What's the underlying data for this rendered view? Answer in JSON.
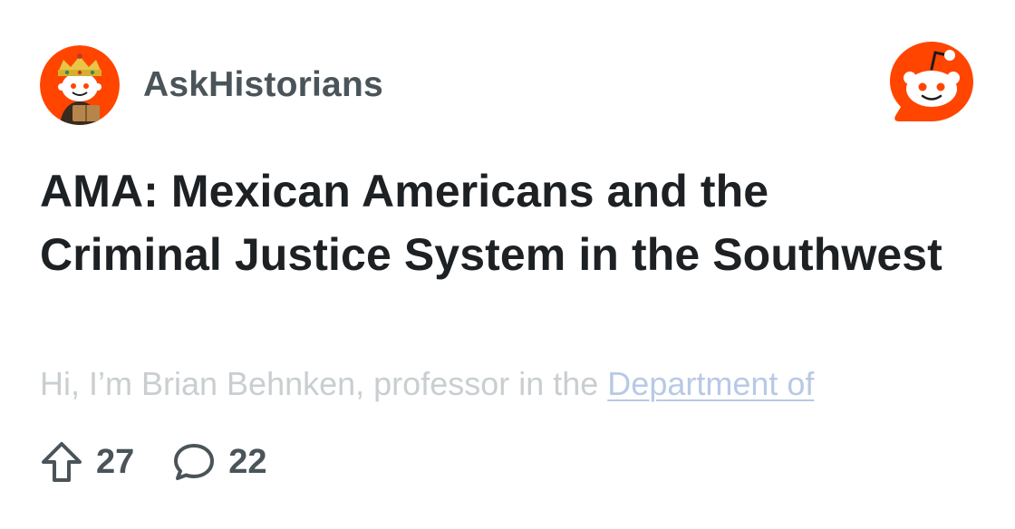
{
  "subreddit": {
    "name": "AskHistorians",
    "avatar_icon": "subreddit-avatar-snoo-crown-icon"
  },
  "brand": {
    "logo_icon": "reddit-logo-icon",
    "color": "#ff4500"
  },
  "post": {
    "title": "AMA: Mexican Americans and the Criminal Justice System in the Southwest",
    "body_preview": "Hi, I’m Brian Behnken, professor in the ",
    "body_link": "Department of"
  },
  "stats": {
    "upvotes": "27",
    "comments": "22",
    "upvote_icon": "upvote-arrow-icon",
    "comment_icon": "comment-bubble-icon"
  }
}
